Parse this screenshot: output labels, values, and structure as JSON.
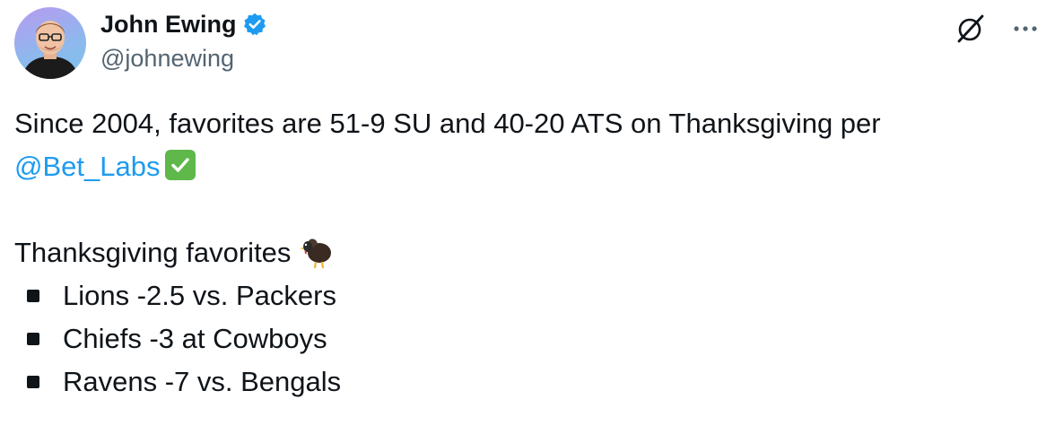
{
  "author": {
    "display_name": "John Ewing",
    "handle": "@johnewing",
    "verified_icon": "verified-badge-icon"
  },
  "actions": {
    "grok_icon": "grok-icon",
    "more_icon": "more-options-icon"
  },
  "tweet": {
    "line1": "Since 2004, favorites are 51-9 SU and 40-20 ATS on Thanksgiving per",
    "mention": "@Bet_Labs",
    "heading": "Thanksgiving favorites",
    "bullets": [
      "Lions -2.5 vs. Packers",
      "Chiefs -3 at Cowboys",
      "Ravens -7 vs. Bengals"
    ]
  },
  "colors": {
    "text": "#0f1419",
    "secondary": "#536471",
    "link": "#1d9bf0",
    "verified": "#1d9bf0",
    "check_emoji": "#5fb84a"
  }
}
